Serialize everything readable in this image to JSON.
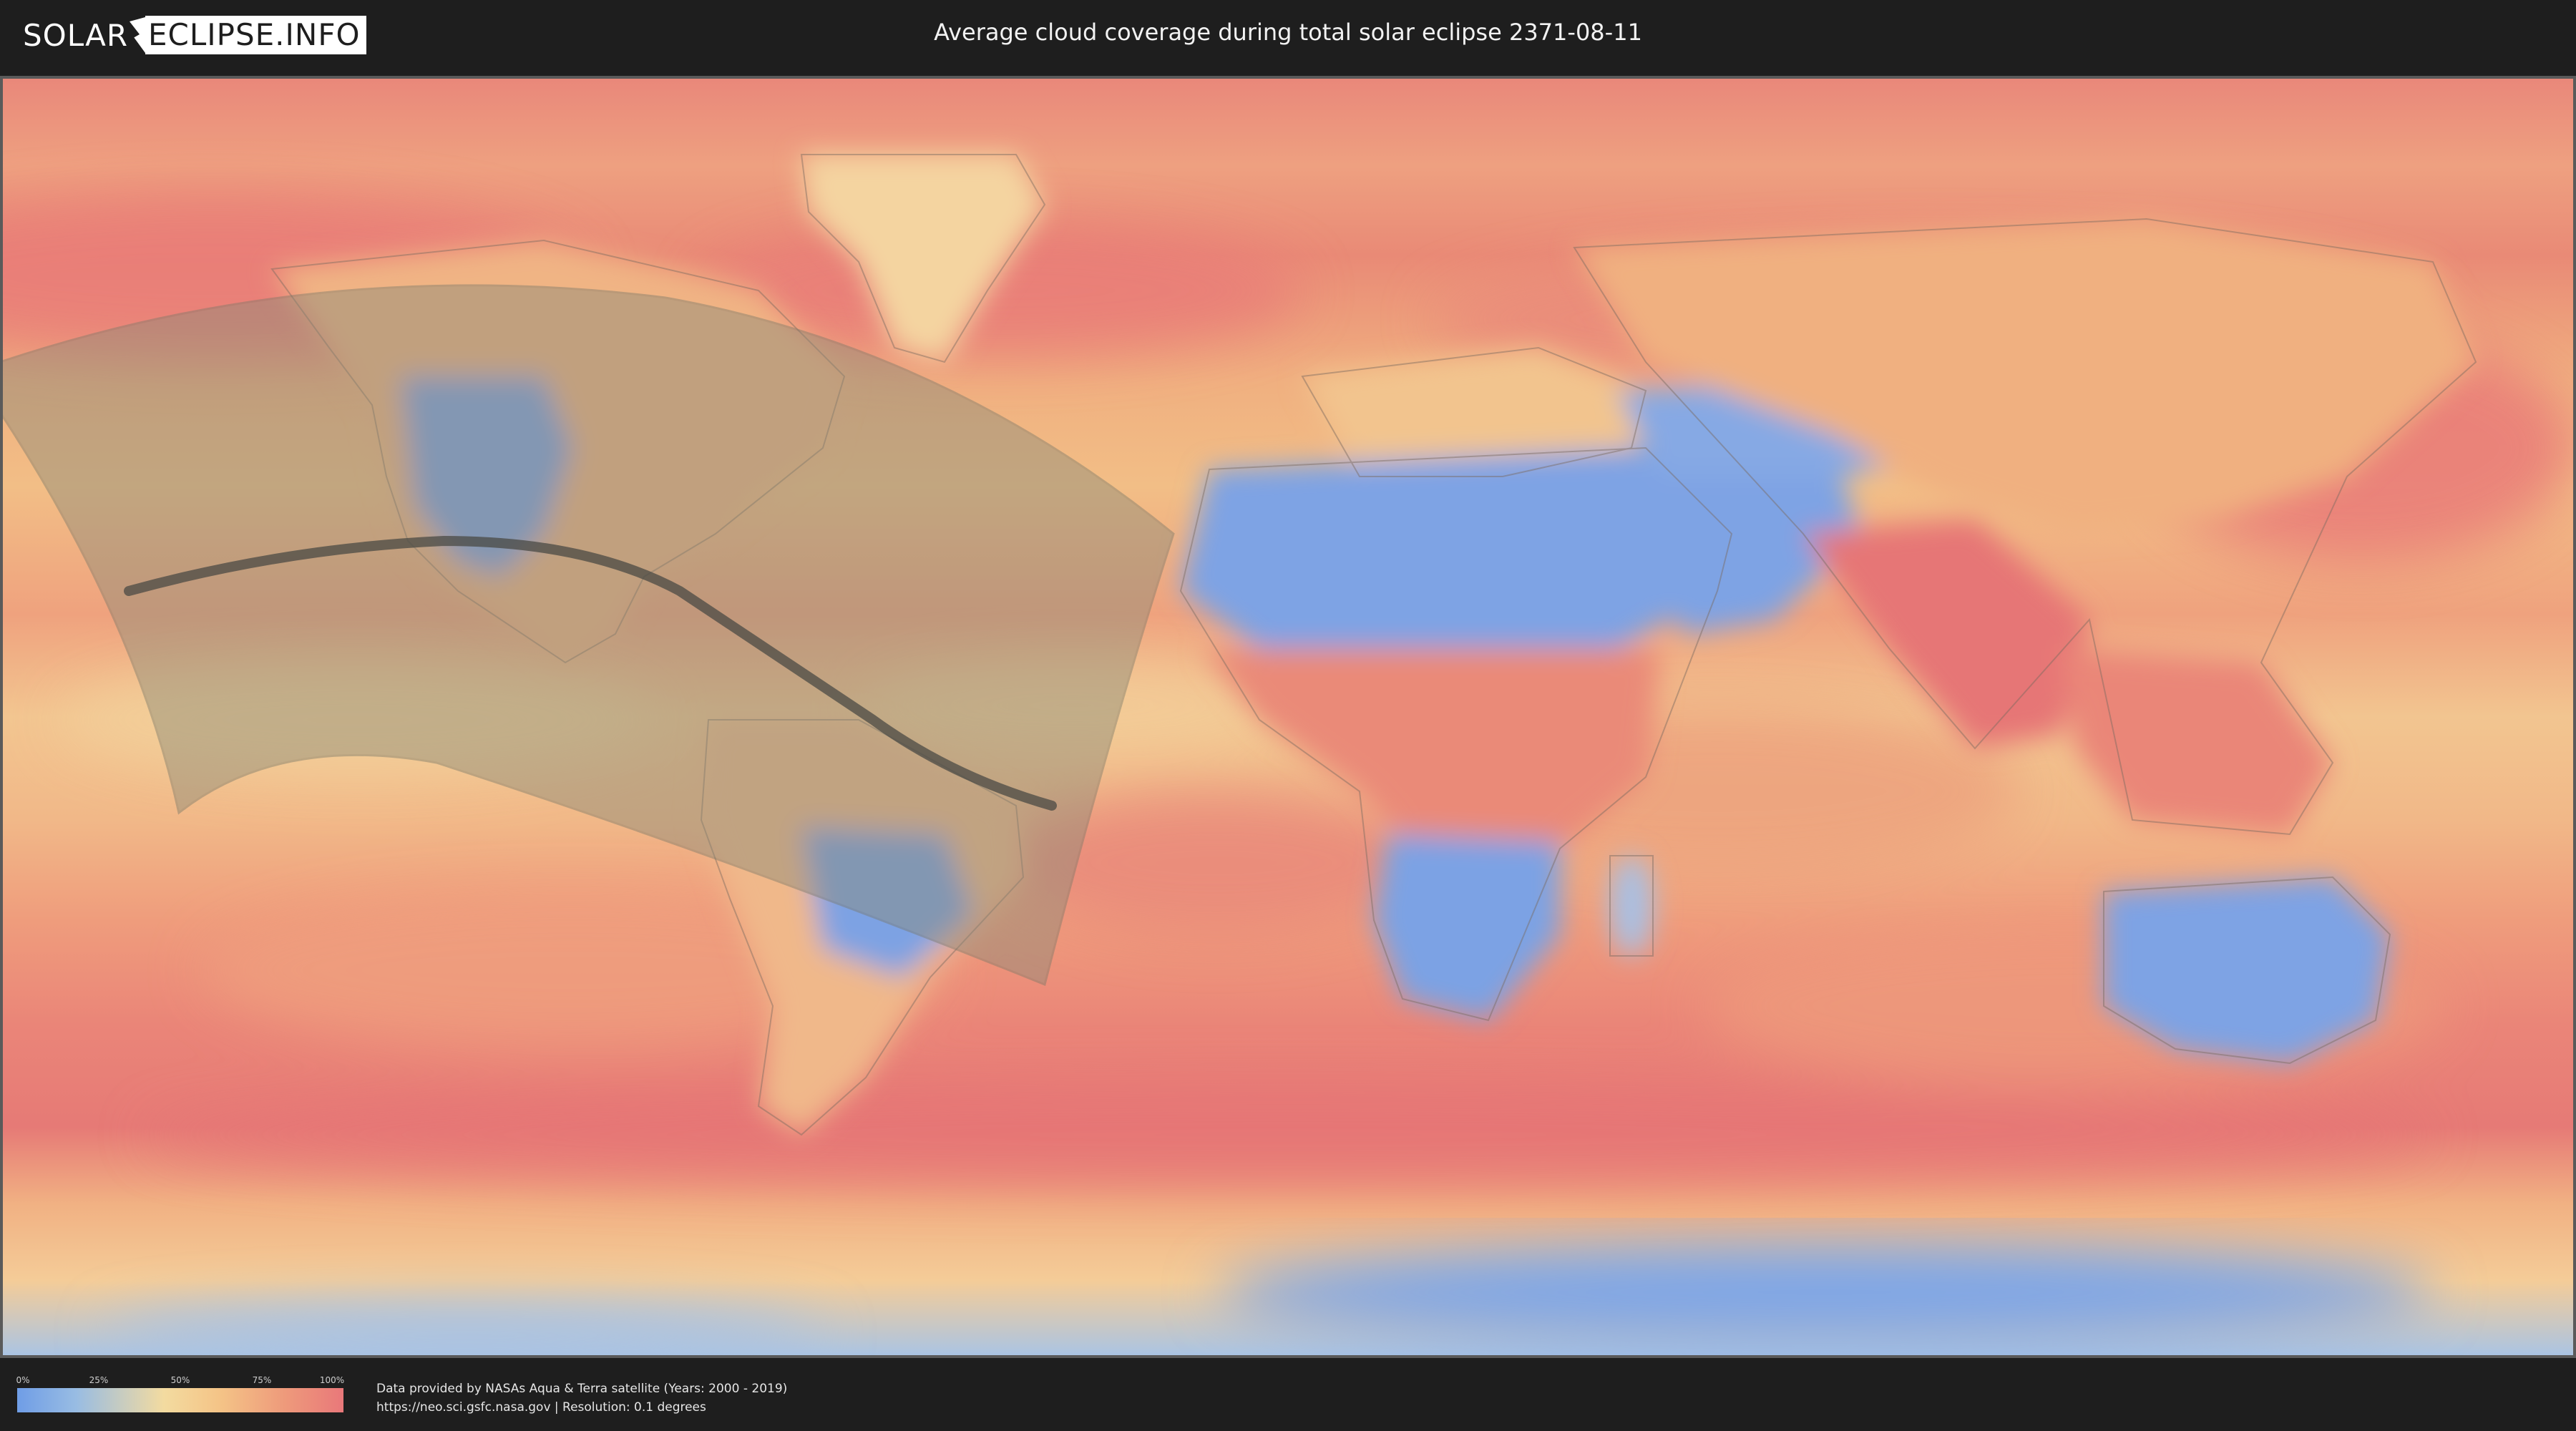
{
  "header": {
    "logo_left": "SOLAR",
    "logo_right": "ECLIPSE.INFO",
    "title": "Average cloud coverage during total solar eclipse 2371-08-11"
  },
  "map": {
    "colors": {
      "low_cloud": "#6f9de6",
      "mid_cloud": "#f3dba0",
      "high_cloud": "#e9787a",
      "eclipse_band": "#8a8a78",
      "central_line": "#4a4a44",
      "coastline": "#7a6a60"
    }
  },
  "legend": {
    "ticks": [
      "0%",
      "25%",
      "50%",
      "75%",
      "100%"
    ],
    "colors": [
      "#6f9de6",
      "#98bce3",
      "#f3dba0",
      "#f4c487",
      "#ee9a7b",
      "#e9787a"
    ]
  },
  "credits": {
    "line1": "Data provided by NASAs Aqua & Terra satellite (Years: 2000 - 2019)",
    "line2": "https://neo.sci.gsfc.nasa.gov | Resolution: 0.1 degrees"
  }
}
